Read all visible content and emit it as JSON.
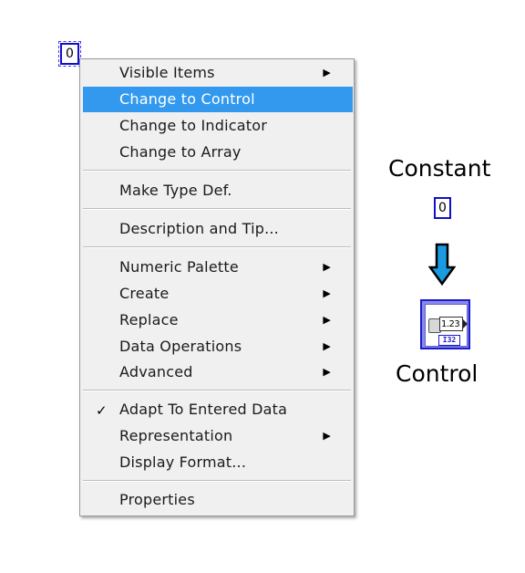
{
  "source_constant": {
    "value": "0"
  },
  "menu": {
    "items": [
      {
        "label": "Visible Items",
        "submenu": true,
        "highlighted": false,
        "checked": false
      },
      {
        "label": "Change to Control",
        "submenu": false,
        "highlighted": true,
        "checked": false
      },
      {
        "label": "Change to Indicator",
        "submenu": false,
        "highlighted": false,
        "checked": false
      },
      {
        "label": "Change to Array",
        "submenu": false,
        "highlighted": false,
        "checked": false
      },
      {
        "label": "Make Type Def.",
        "submenu": false,
        "highlighted": false,
        "checked": false
      },
      {
        "label": "Description and Tip...",
        "submenu": false,
        "highlighted": false,
        "checked": false
      },
      {
        "label": "Numeric Palette",
        "submenu": true,
        "highlighted": false,
        "checked": false
      },
      {
        "label": "Create",
        "submenu": true,
        "highlighted": false,
        "checked": false
      },
      {
        "label": "Replace",
        "submenu": true,
        "highlighted": false,
        "checked": false
      },
      {
        "label": "Data Operations",
        "submenu": true,
        "highlighted": false,
        "checked": false
      },
      {
        "label": "Advanced",
        "submenu": true,
        "highlighted": false,
        "checked": false
      },
      {
        "label": "Adapt To Entered Data",
        "submenu": false,
        "highlighted": false,
        "checked": true
      },
      {
        "label": "Representation",
        "submenu": true,
        "highlighted": false,
        "checked": false
      },
      {
        "label": "Display Format...",
        "submenu": false,
        "highlighted": false,
        "checked": false
      },
      {
        "label": "Properties",
        "submenu": false,
        "highlighted": false,
        "checked": false
      }
    ],
    "submenu_glyph": "▶",
    "check_glyph": "✓"
  },
  "illustration": {
    "constant_caption": "Constant",
    "constant_value": "0",
    "control_caption": "Control",
    "control_value": "1.23",
    "control_type_label": "I32",
    "arrow_fill_color": "#1a9be0"
  },
  "colors": {
    "highlight": "#3399ee",
    "node_border": "#1010c8"
  }
}
